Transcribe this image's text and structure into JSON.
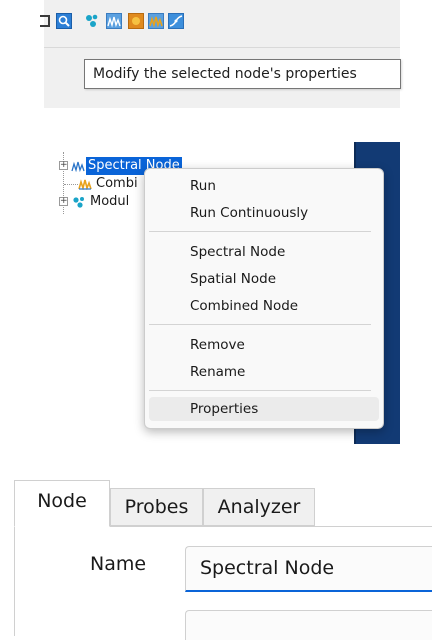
{
  "toolbar": {
    "buttons": [
      {
        "icon": "partial-window-icon"
      },
      {
        "icon": "node-properties-icon"
      },
      {
        "icon": "module-node-icon"
      },
      {
        "icon": "spectral-node-icon"
      },
      {
        "icon": "spatial-node-icon"
      },
      {
        "icon": "combined-node-icon"
      },
      {
        "icon": "curve-edit-icon"
      }
    ],
    "tooltip": "Modify the selected node's properties"
  },
  "tree": {
    "rows": [
      {
        "label": "Spectral Node",
        "selected": true
      },
      {
        "label": "Combi"
      },
      {
        "label": "Modul"
      }
    ]
  },
  "context_menu": {
    "items": [
      {
        "label": "Run"
      },
      {
        "label": "Run Continuously"
      },
      {
        "label": "Spectral Node"
      },
      {
        "label": "Spatial Node"
      },
      {
        "label": "Combined Node"
      },
      {
        "label": "Remove"
      },
      {
        "label": "Rename"
      },
      {
        "label": "Properties",
        "hovered": true
      }
    ]
  },
  "properties": {
    "tabs": [
      {
        "label": "Node",
        "active": true
      },
      {
        "label": "Probes"
      },
      {
        "label": "Analyzer"
      }
    ],
    "name_label": "Name",
    "name_value": "Spectral Node"
  },
  "colors": {
    "selection": "#0a64d8",
    "toolbar_bg": "#f0f0f0",
    "side_panel": "#123a74",
    "spectral_icon": "#e8a21c",
    "module_icon": "#1aa4c8"
  }
}
